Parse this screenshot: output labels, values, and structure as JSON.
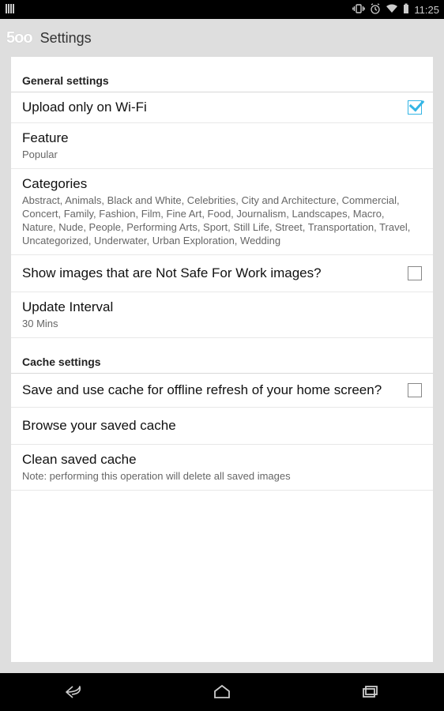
{
  "status": {
    "time": "11:25"
  },
  "action_bar": {
    "logo": "5oo",
    "title": "Settings"
  },
  "sections": {
    "general": {
      "header": "General settings"
    },
    "cache": {
      "header": "Cache settings"
    }
  },
  "prefs": {
    "upload_wifi": {
      "title": "Upload only on Wi-Fi"
    },
    "feature": {
      "title": "Feature",
      "summary": "Popular"
    },
    "categories": {
      "title": "Categories",
      "summary": "Abstract, Animals, Black and White, Celebrities, City and Architecture, Commercial, Concert, Family, Fashion, Film, Fine Art, Food, Journalism, Landscapes, Macro, Nature, Nude, People, Performing Arts, Sport, Still Life, Street, Transportation, Travel, Uncategorized, Underwater, Urban Exploration, Wedding"
    },
    "nsfw": {
      "title": "Show images that are Not Safe For Work images?"
    },
    "interval": {
      "title": "Update Interval",
      "summary": "30 Mins"
    },
    "cache_save": {
      "title": "Save and use cache for offline refresh of your home screen?"
    },
    "cache_browse": {
      "title": "Browse your saved cache"
    },
    "cache_clean": {
      "title": "Clean saved cache",
      "summary": "Note: performing this operation will delete all saved images"
    }
  }
}
